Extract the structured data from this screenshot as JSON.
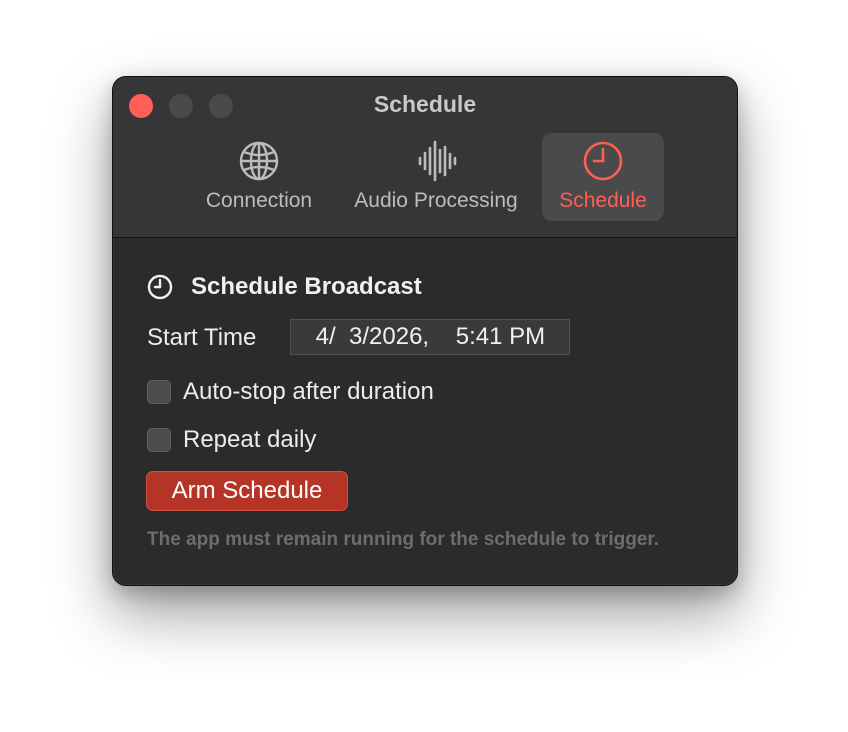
{
  "window": {
    "title": "Schedule"
  },
  "toolbar": {
    "items": [
      {
        "label": "Connection",
        "icon": "globe-icon",
        "active": false
      },
      {
        "label": "Audio Processing",
        "icon": "waveform-icon",
        "active": false
      },
      {
        "label": "Schedule",
        "icon": "clock-icon",
        "active": true
      }
    ]
  },
  "schedule": {
    "section_title": "Schedule Broadcast",
    "section_icon": "clock-icon",
    "start_time_label": "Start Time",
    "start_time_value": " 4/  3/2026,    5:41 PM",
    "auto_stop_label": "Auto-stop after duration",
    "auto_stop_checked": false,
    "repeat_label": "Repeat daily",
    "repeat_checked": false,
    "arm_button_label": "Arm Schedule",
    "note": "The app must remain running for the schedule to trigger."
  },
  "colors": {
    "accent": "#ff5f52",
    "arm_button": "#b63426",
    "close_button": "#ff5f57",
    "window_bg": "#2b2b2c",
    "titlebar_bg": "#363638"
  }
}
